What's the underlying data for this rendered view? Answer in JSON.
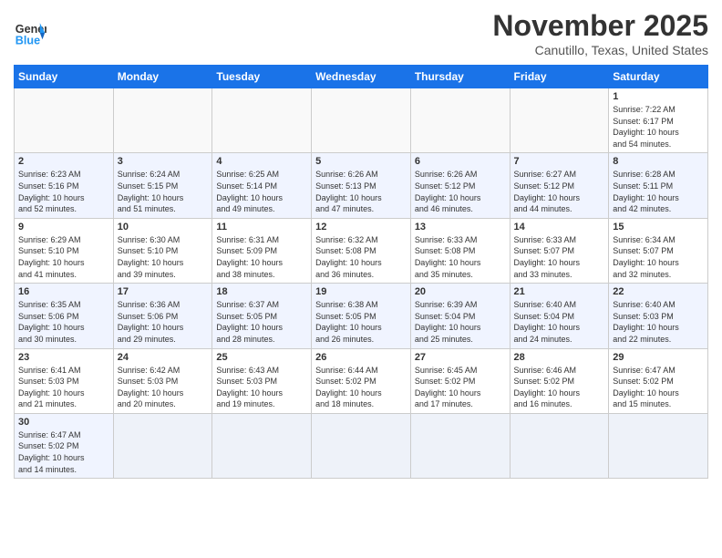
{
  "header": {
    "logo_general": "General",
    "logo_blue": "Blue",
    "month": "November 2025",
    "location": "Canutillo, Texas, United States"
  },
  "days_of_week": [
    "Sunday",
    "Monday",
    "Tuesday",
    "Wednesday",
    "Thursday",
    "Friday",
    "Saturday"
  ],
  "weeks": [
    [
      {
        "day": "",
        "info": ""
      },
      {
        "day": "",
        "info": ""
      },
      {
        "day": "",
        "info": ""
      },
      {
        "day": "",
        "info": ""
      },
      {
        "day": "",
        "info": ""
      },
      {
        "day": "",
        "info": ""
      },
      {
        "day": "1",
        "info": "Sunrise: 7:22 AM\nSunset: 6:17 PM\nDaylight: 10 hours\nand 54 minutes."
      }
    ],
    [
      {
        "day": "2",
        "info": "Sunrise: 6:23 AM\nSunset: 5:16 PM\nDaylight: 10 hours\nand 52 minutes."
      },
      {
        "day": "3",
        "info": "Sunrise: 6:24 AM\nSunset: 5:15 PM\nDaylight: 10 hours\nand 51 minutes."
      },
      {
        "day": "4",
        "info": "Sunrise: 6:25 AM\nSunset: 5:14 PM\nDaylight: 10 hours\nand 49 minutes."
      },
      {
        "day": "5",
        "info": "Sunrise: 6:26 AM\nSunset: 5:13 PM\nDaylight: 10 hours\nand 47 minutes."
      },
      {
        "day": "6",
        "info": "Sunrise: 6:26 AM\nSunset: 5:12 PM\nDaylight: 10 hours\nand 46 minutes."
      },
      {
        "day": "7",
        "info": "Sunrise: 6:27 AM\nSunset: 5:12 PM\nDaylight: 10 hours\nand 44 minutes."
      },
      {
        "day": "8",
        "info": "Sunrise: 6:28 AM\nSunset: 5:11 PM\nDaylight: 10 hours\nand 42 minutes."
      }
    ],
    [
      {
        "day": "9",
        "info": "Sunrise: 6:29 AM\nSunset: 5:10 PM\nDaylight: 10 hours\nand 41 minutes."
      },
      {
        "day": "10",
        "info": "Sunrise: 6:30 AM\nSunset: 5:10 PM\nDaylight: 10 hours\nand 39 minutes."
      },
      {
        "day": "11",
        "info": "Sunrise: 6:31 AM\nSunset: 5:09 PM\nDaylight: 10 hours\nand 38 minutes."
      },
      {
        "day": "12",
        "info": "Sunrise: 6:32 AM\nSunset: 5:08 PM\nDaylight: 10 hours\nand 36 minutes."
      },
      {
        "day": "13",
        "info": "Sunrise: 6:33 AM\nSunset: 5:08 PM\nDaylight: 10 hours\nand 35 minutes."
      },
      {
        "day": "14",
        "info": "Sunrise: 6:33 AM\nSunset: 5:07 PM\nDaylight: 10 hours\nand 33 minutes."
      },
      {
        "day": "15",
        "info": "Sunrise: 6:34 AM\nSunset: 5:07 PM\nDaylight: 10 hours\nand 32 minutes."
      }
    ],
    [
      {
        "day": "16",
        "info": "Sunrise: 6:35 AM\nSunset: 5:06 PM\nDaylight: 10 hours\nand 30 minutes."
      },
      {
        "day": "17",
        "info": "Sunrise: 6:36 AM\nSunset: 5:06 PM\nDaylight: 10 hours\nand 29 minutes."
      },
      {
        "day": "18",
        "info": "Sunrise: 6:37 AM\nSunset: 5:05 PM\nDaylight: 10 hours\nand 28 minutes."
      },
      {
        "day": "19",
        "info": "Sunrise: 6:38 AM\nSunset: 5:05 PM\nDaylight: 10 hours\nand 26 minutes."
      },
      {
        "day": "20",
        "info": "Sunrise: 6:39 AM\nSunset: 5:04 PM\nDaylight: 10 hours\nand 25 minutes."
      },
      {
        "day": "21",
        "info": "Sunrise: 6:40 AM\nSunset: 5:04 PM\nDaylight: 10 hours\nand 24 minutes."
      },
      {
        "day": "22",
        "info": "Sunrise: 6:40 AM\nSunset: 5:03 PM\nDaylight: 10 hours\nand 22 minutes."
      }
    ],
    [
      {
        "day": "23",
        "info": "Sunrise: 6:41 AM\nSunset: 5:03 PM\nDaylight: 10 hours\nand 21 minutes."
      },
      {
        "day": "24",
        "info": "Sunrise: 6:42 AM\nSunset: 5:03 PM\nDaylight: 10 hours\nand 20 minutes."
      },
      {
        "day": "25",
        "info": "Sunrise: 6:43 AM\nSunset: 5:03 PM\nDaylight: 10 hours\nand 19 minutes."
      },
      {
        "day": "26",
        "info": "Sunrise: 6:44 AM\nSunset: 5:02 PM\nDaylight: 10 hours\nand 18 minutes."
      },
      {
        "day": "27",
        "info": "Sunrise: 6:45 AM\nSunset: 5:02 PM\nDaylight: 10 hours\nand 17 minutes."
      },
      {
        "day": "28",
        "info": "Sunrise: 6:46 AM\nSunset: 5:02 PM\nDaylight: 10 hours\nand 16 minutes."
      },
      {
        "day": "29",
        "info": "Sunrise: 6:47 AM\nSunset: 5:02 PM\nDaylight: 10 hours\nand 15 minutes."
      }
    ],
    [
      {
        "day": "30",
        "info": "Sunrise: 6:47 AM\nSunset: 5:02 PM\nDaylight: 10 hours\nand 14 minutes."
      },
      {
        "day": "",
        "info": ""
      },
      {
        "day": "",
        "info": ""
      },
      {
        "day": "",
        "info": ""
      },
      {
        "day": "",
        "info": ""
      },
      {
        "day": "",
        "info": ""
      },
      {
        "day": "",
        "info": ""
      }
    ]
  ]
}
